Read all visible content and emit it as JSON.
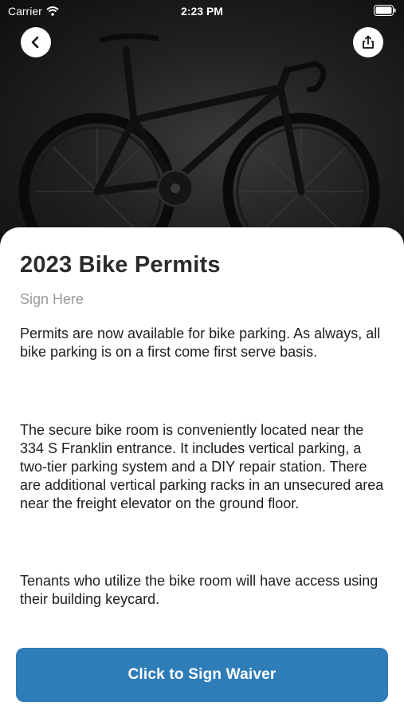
{
  "status_bar": {
    "carrier": "Carrier",
    "time": "2:23 PM"
  },
  "hero": {
    "image_subject": "bike-photo",
    "back_icon": "chevron-left-icon",
    "share_icon": "share-icon"
  },
  "content": {
    "title": "2023 Bike Permits",
    "subtitle": "Sign Here",
    "paragraphs": [
      "Permits are now available for bike parking. As always, all bike parking is on a first come first serve basis.",
      "The secure bike room is conveniently located near the 334 S Franklin entrance. It includes vertical parking, a two-tier parking system and a DIY repair station. There are additional vertical parking racks in an unsecured area near the freight elevator on the ground floor.",
      "Tenants who utilize the bike room will have access using their building keycard."
    ]
  },
  "cta": {
    "label": "Click to Sign Waiver"
  },
  "colors": {
    "accent": "#2f7db8",
    "title": "#2b2b2b",
    "subtitle": "#9a9a9a"
  }
}
